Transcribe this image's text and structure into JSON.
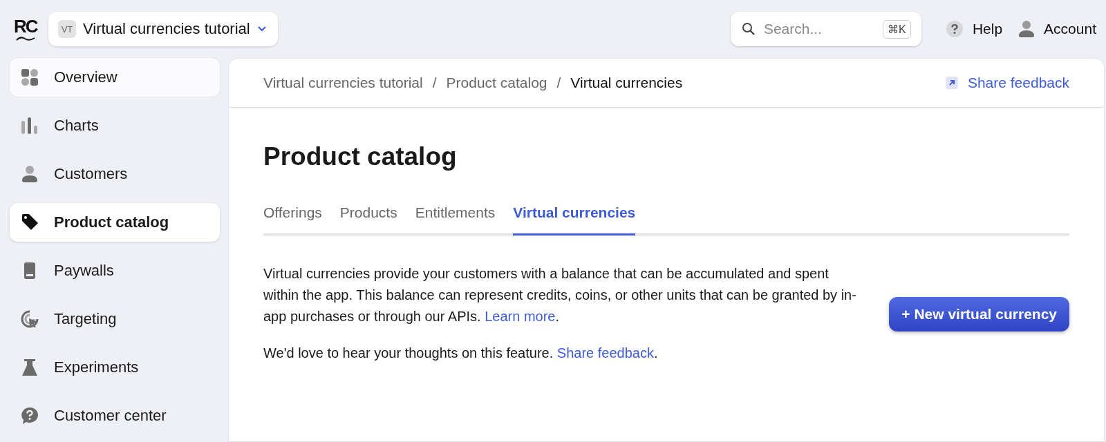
{
  "logo": "RC",
  "project": {
    "initials": "VT",
    "name": "Virtual currencies tutorial"
  },
  "search": {
    "placeholder": "Search...",
    "shortcut": "⌘K"
  },
  "top_links": [
    "Help",
    "Account"
  ],
  "sidebar": {
    "items": [
      {
        "label": "Overview",
        "selected": false,
        "hovered": true
      },
      {
        "label": "Charts",
        "selected": false,
        "hovered": false
      },
      {
        "label": "Customers",
        "selected": false,
        "hovered": false
      },
      {
        "label": "Product catalog",
        "selected": true,
        "hovered": false
      },
      {
        "label": "Paywalls",
        "selected": false,
        "hovered": false
      },
      {
        "label": "Targeting",
        "selected": false,
        "hovered": false
      },
      {
        "label": "Experiments",
        "selected": false,
        "hovered": false
      },
      {
        "label": "Customer center",
        "selected": false,
        "hovered": false
      }
    ]
  },
  "breadcrumb": [
    "Virtual currencies tutorial",
    "Product catalog",
    "Virtual currencies"
  ],
  "breadcrumb_separator": "/",
  "share_feedback": "Share feedback",
  "title": "Product catalog",
  "tabs": [
    {
      "label": "Offerings",
      "selected": false
    },
    {
      "label": "Products",
      "selected": false
    },
    {
      "label": "Entitlements",
      "selected": false
    },
    {
      "label": "Virtual currencies",
      "selected": true
    }
  ],
  "paragraphs": [
    {
      "text": "Virtual currencies provide your customers with a balance that can be accumulated and spent within the app. This balance can represent credits, coins, or other units that can be granted by in-app purchases or through our APIs.",
      "link": "Learn more",
      "after": "."
    },
    {
      "text": "We'd love to hear your thoughts on this feature.",
      "link": "Share feedback",
      "after": "."
    }
  ],
  "new_button": "+ New virtual currency"
}
